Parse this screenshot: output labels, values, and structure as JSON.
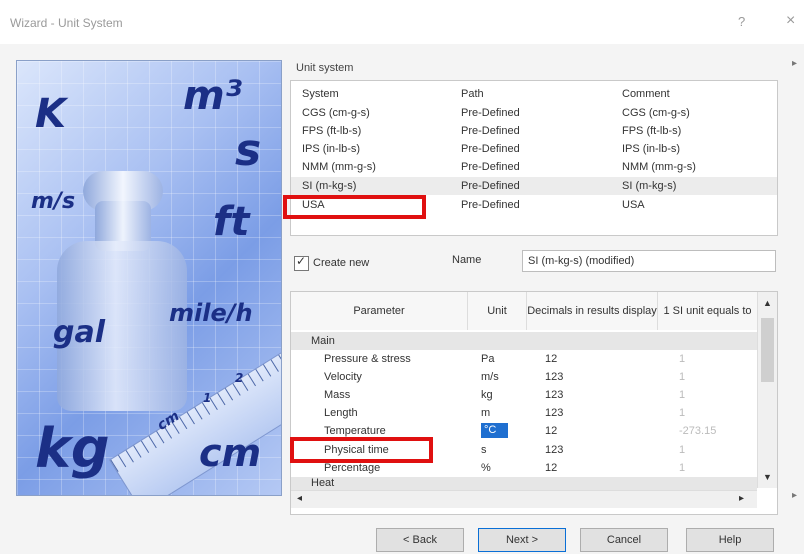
{
  "window": {
    "title": "Wizard - Unit System",
    "help": "?",
    "close": "×"
  },
  "art": {
    "glyphs": [
      "K",
      "m³",
      "s",
      "m/s",
      "ft",
      "gal",
      "mile/h",
      "kg",
      "cm",
      "cm",
      "1",
      "2"
    ]
  },
  "unit_system": {
    "label": "Unit system",
    "columns": [
      "System",
      "Path",
      "Comment"
    ],
    "rows": [
      {
        "system": "CGS (cm-g-s)",
        "path": "Pre-Defined",
        "comment": "CGS (cm-g-s)"
      },
      {
        "system": "FPS (ft-lb-s)",
        "path": "Pre-Defined",
        "comment": "FPS (ft-lb-s)"
      },
      {
        "system": "IPS (in-lb-s)",
        "path": "Pre-Defined",
        "comment": "IPS (in-lb-s)"
      },
      {
        "system": "NMM (mm-g-s)",
        "path": "Pre-Defined",
        "comment": "NMM (mm-g-s)"
      },
      {
        "system": "SI (m-kg-s)",
        "path": "Pre-Defined",
        "comment": "SI (m-kg-s)"
      },
      {
        "system": "USA",
        "path": "Pre-Defined",
        "comment": "USA"
      }
    ]
  },
  "create_new": {
    "label": "Create new",
    "checked": true
  },
  "name": {
    "label": "Name",
    "value": "SI (m-kg-s) (modified)"
  },
  "parameters": {
    "columns": [
      "Parameter",
      "Unit",
      "Decimals in results display",
      "1 SI unit equals to"
    ],
    "group_main": "Main",
    "rows": [
      {
        "name": "Pressure & stress",
        "unit": "Pa",
        "decimals": "12",
        "si": "1"
      },
      {
        "name": "Velocity",
        "unit": "m/s",
        "decimals": "123",
        "si": "1"
      },
      {
        "name": "Mass",
        "unit": "kg",
        "decimals": "123",
        "si": "1"
      },
      {
        "name": "Length",
        "unit": "m",
        "decimals": "123",
        "si": "1"
      },
      {
        "name": "Temperature",
        "unit": "°C",
        "decimals": "12",
        "si": "-273.15"
      },
      {
        "name": "Physical time",
        "unit": "s",
        "decimals": "123",
        "si": "1"
      },
      {
        "name": "Percentage",
        "unit": "%",
        "decimals": "12",
        "si": "1"
      }
    ],
    "group_next": "Heat"
  },
  "buttons": {
    "back": "< Back",
    "next": "Next >",
    "cancel": "Cancel",
    "help": "Help"
  },
  "colors": {
    "highlight": "#1f6fd0",
    "annotation": "#e01010"
  }
}
